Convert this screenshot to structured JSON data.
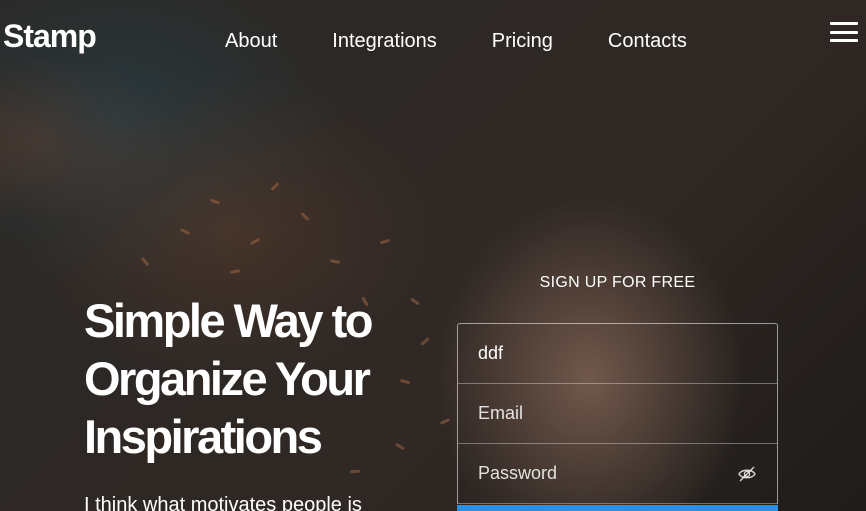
{
  "brand": {
    "logo": "Stamp"
  },
  "nav": {
    "items": [
      {
        "label": "About"
      },
      {
        "label": "Integrations"
      },
      {
        "label": "Pricing"
      },
      {
        "label": "Contacts"
      }
    ],
    "menu_icon": "hamburger-menu-icon"
  },
  "hero": {
    "headline": "Simple Way to Organize Your Inspirations",
    "lead": "I think what motivates people is"
  },
  "signup": {
    "title": "SIGN UP FOR FREE",
    "name_value": "ddf",
    "email_placeholder": "Email",
    "password_placeholder": "Password",
    "password_toggle_icon": "eye-slash-icon",
    "submit_color": "#2e8fe0"
  }
}
